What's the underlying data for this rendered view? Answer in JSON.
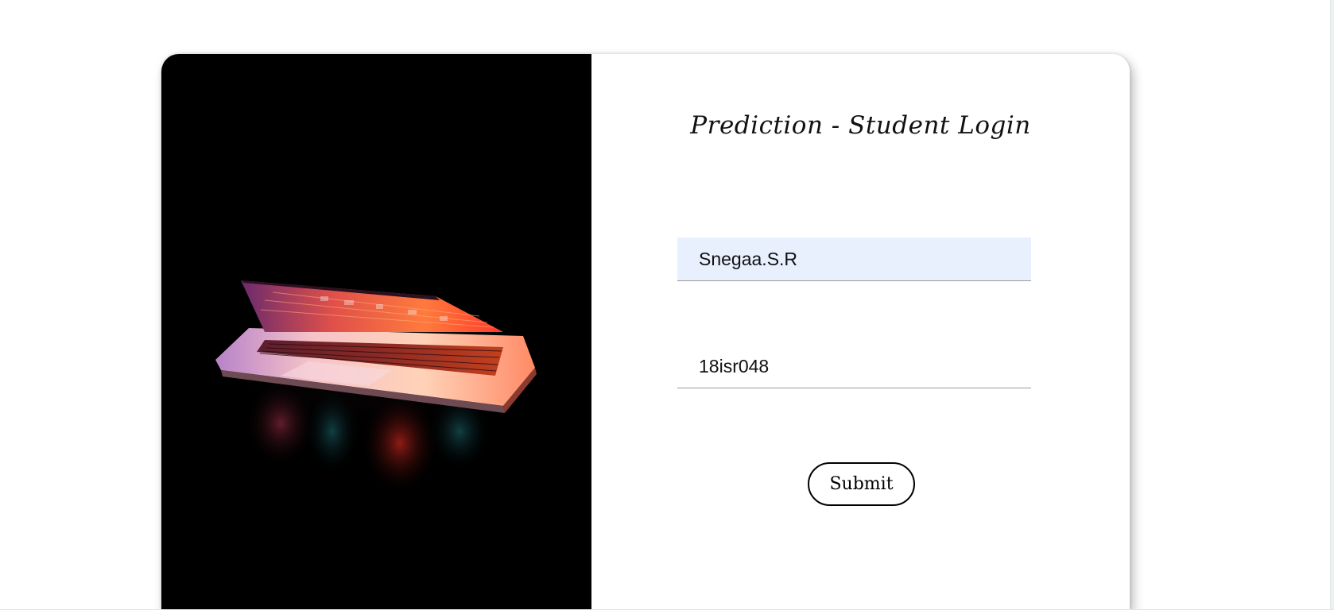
{
  "login": {
    "title": "Prediction - Student Login",
    "username_value": "Snegaa.S.R",
    "password_value": "18isr048",
    "submit_label": "Submit"
  },
  "colors": {
    "photo_background": "#000000",
    "autofill_background": "#e8f0fe",
    "field_underline": "#9a9a9a",
    "button_border": "#000000"
  },
  "icons": {
    "hero_image": "laptop-glowing-keyboard-photo"
  }
}
